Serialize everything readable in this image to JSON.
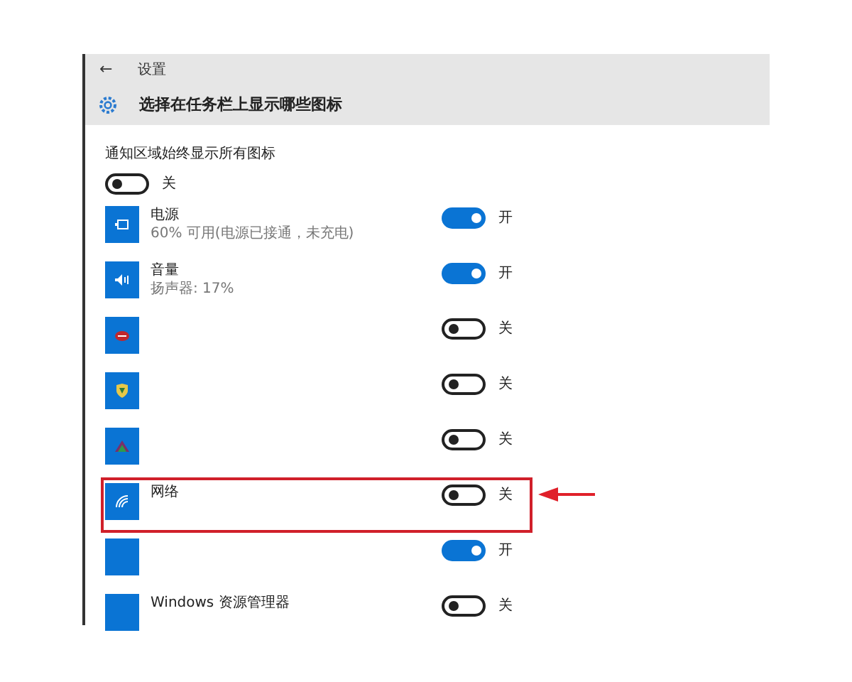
{
  "window": {
    "title": "设置",
    "back": "←"
  },
  "page_title": "选择在任务栏上显示哪些图标",
  "master": {
    "label": "通知区域始终显示所有图标",
    "on": false,
    "state_label": "关"
  },
  "rows": [
    {
      "name": "电源",
      "detail": "60% 可用(电源已接通，未充电)",
      "on": true,
      "state_label": "开",
      "highlighted": false
    },
    {
      "name": "音量",
      "detail": "扬声器: 17%",
      "on": true,
      "state_label": "开",
      "highlighted": false
    },
    {
      "on": false,
      "state_label": "关",
      "highlighted": false
    },
    {
      "on": false,
      "state_label": "关",
      "highlighted": false
    },
    {
      "on": false,
      "state_label": "关",
      "highlighted": false
    },
    {
      "name": "网络",
      "on": false,
      "state_label": "关",
      "highlighted": true
    },
    {
      "on": true,
      "state_label": "开",
      "highlighted": false
    },
    {
      "name": "Windows 资源管理器",
      "on": false,
      "state_label": "关",
      "highlighted": false
    }
  ]
}
